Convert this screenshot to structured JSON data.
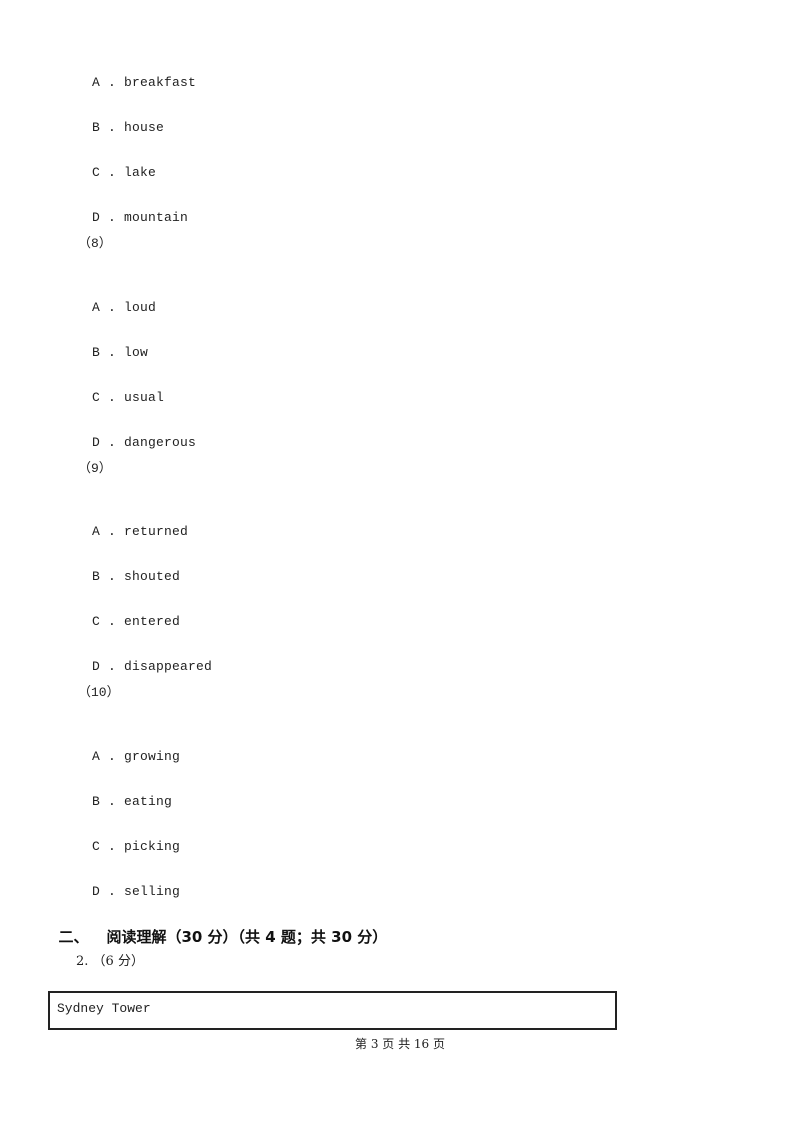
{
  "questions": [
    {
      "number": "",
      "options": [
        {
          "letter": "A",
          "text": "breakfast"
        },
        {
          "letter": "B",
          "text": "house"
        },
        {
          "letter": "C",
          "text": "lake"
        },
        {
          "letter": "D",
          "text": "mountain"
        }
      ]
    },
    {
      "number": "（8）",
      "options": [
        {
          "letter": "A",
          "text": "loud"
        },
        {
          "letter": "B",
          "text": "low"
        },
        {
          "letter": "C",
          "text": "usual"
        },
        {
          "letter": "D",
          "text": "dangerous"
        }
      ]
    },
    {
      "number": "（9）",
      "options": [
        {
          "letter": "A",
          "text": "returned"
        },
        {
          "letter": "B",
          "text": "shouted"
        },
        {
          "letter": "C",
          "text": "entered"
        },
        {
          "letter": "D",
          "text": "disappeared"
        }
      ]
    },
    {
      "number": "（10）",
      "options": [
        {
          "letter": "A",
          "text": "growing"
        },
        {
          "letter": "B",
          "text": "eating"
        },
        {
          "letter": "C",
          "text": "picking"
        },
        {
          "letter": "D",
          "text": "selling"
        }
      ]
    }
  ],
  "option_separator": " . ",
  "section": {
    "number": "二、",
    "title": "阅读理解（30 分）（共 4 题；共 30 分）"
  },
  "question_header": {
    "label": "2. （6 分）"
  },
  "passage": {
    "title": "Sydney Tower"
  },
  "footer": {
    "page_text": "第 3 页 共 16 页"
  }
}
